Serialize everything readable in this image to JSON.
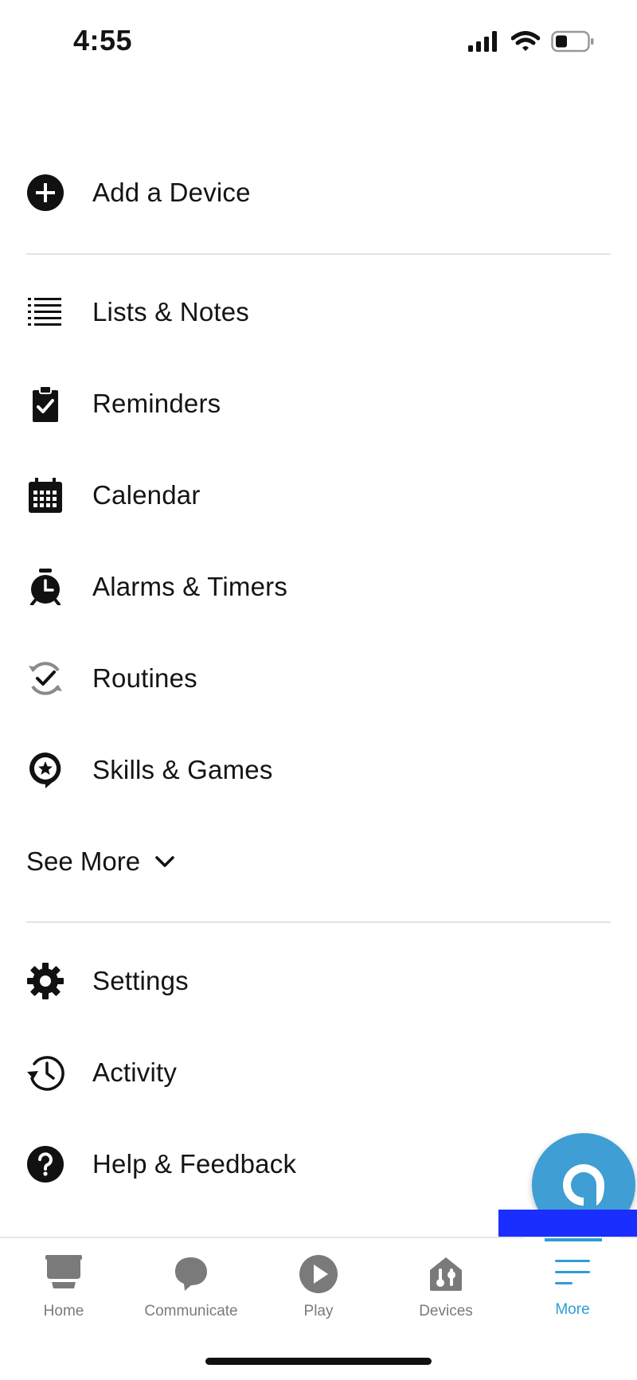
{
  "status": {
    "time": "4:55"
  },
  "menu": {
    "add_device": "Add a Device",
    "items": [
      {
        "label": "Lists & Notes",
        "icon": "list-icon"
      },
      {
        "label": "Reminders",
        "icon": "clipboard-check-icon"
      },
      {
        "label": "Calendar",
        "icon": "calendar-icon"
      },
      {
        "label": "Alarms & Timers",
        "icon": "alarm-clock-icon"
      },
      {
        "label": "Routines",
        "icon": "routine-check-icon"
      },
      {
        "label": "Skills & Games",
        "icon": "star-bubble-icon"
      }
    ],
    "see_more": "See More",
    "settings": "Settings",
    "activity": "Activity",
    "help": "Help & Feedback"
  },
  "bottom_nav": [
    {
      "label": "Home",
      "icon": "home-icon"
    },
    {
      "label": "Communicate",
      "icon": "chat-bubble-icon"
    },
    {
      "label": "Play",
      "icon": "play-icon"
    },
    {
      "label": "Devices",
      "icon": "devices-icon"
    },
    {
      "label": "More",
      "icon": "menu-icon",
      "active": true
    }
  ],
  "colors": {
    "accent": "#2b9fd6",
    "alexa": "#3f9ed3",
    "highlight": "#1a2eff"
  }
}
